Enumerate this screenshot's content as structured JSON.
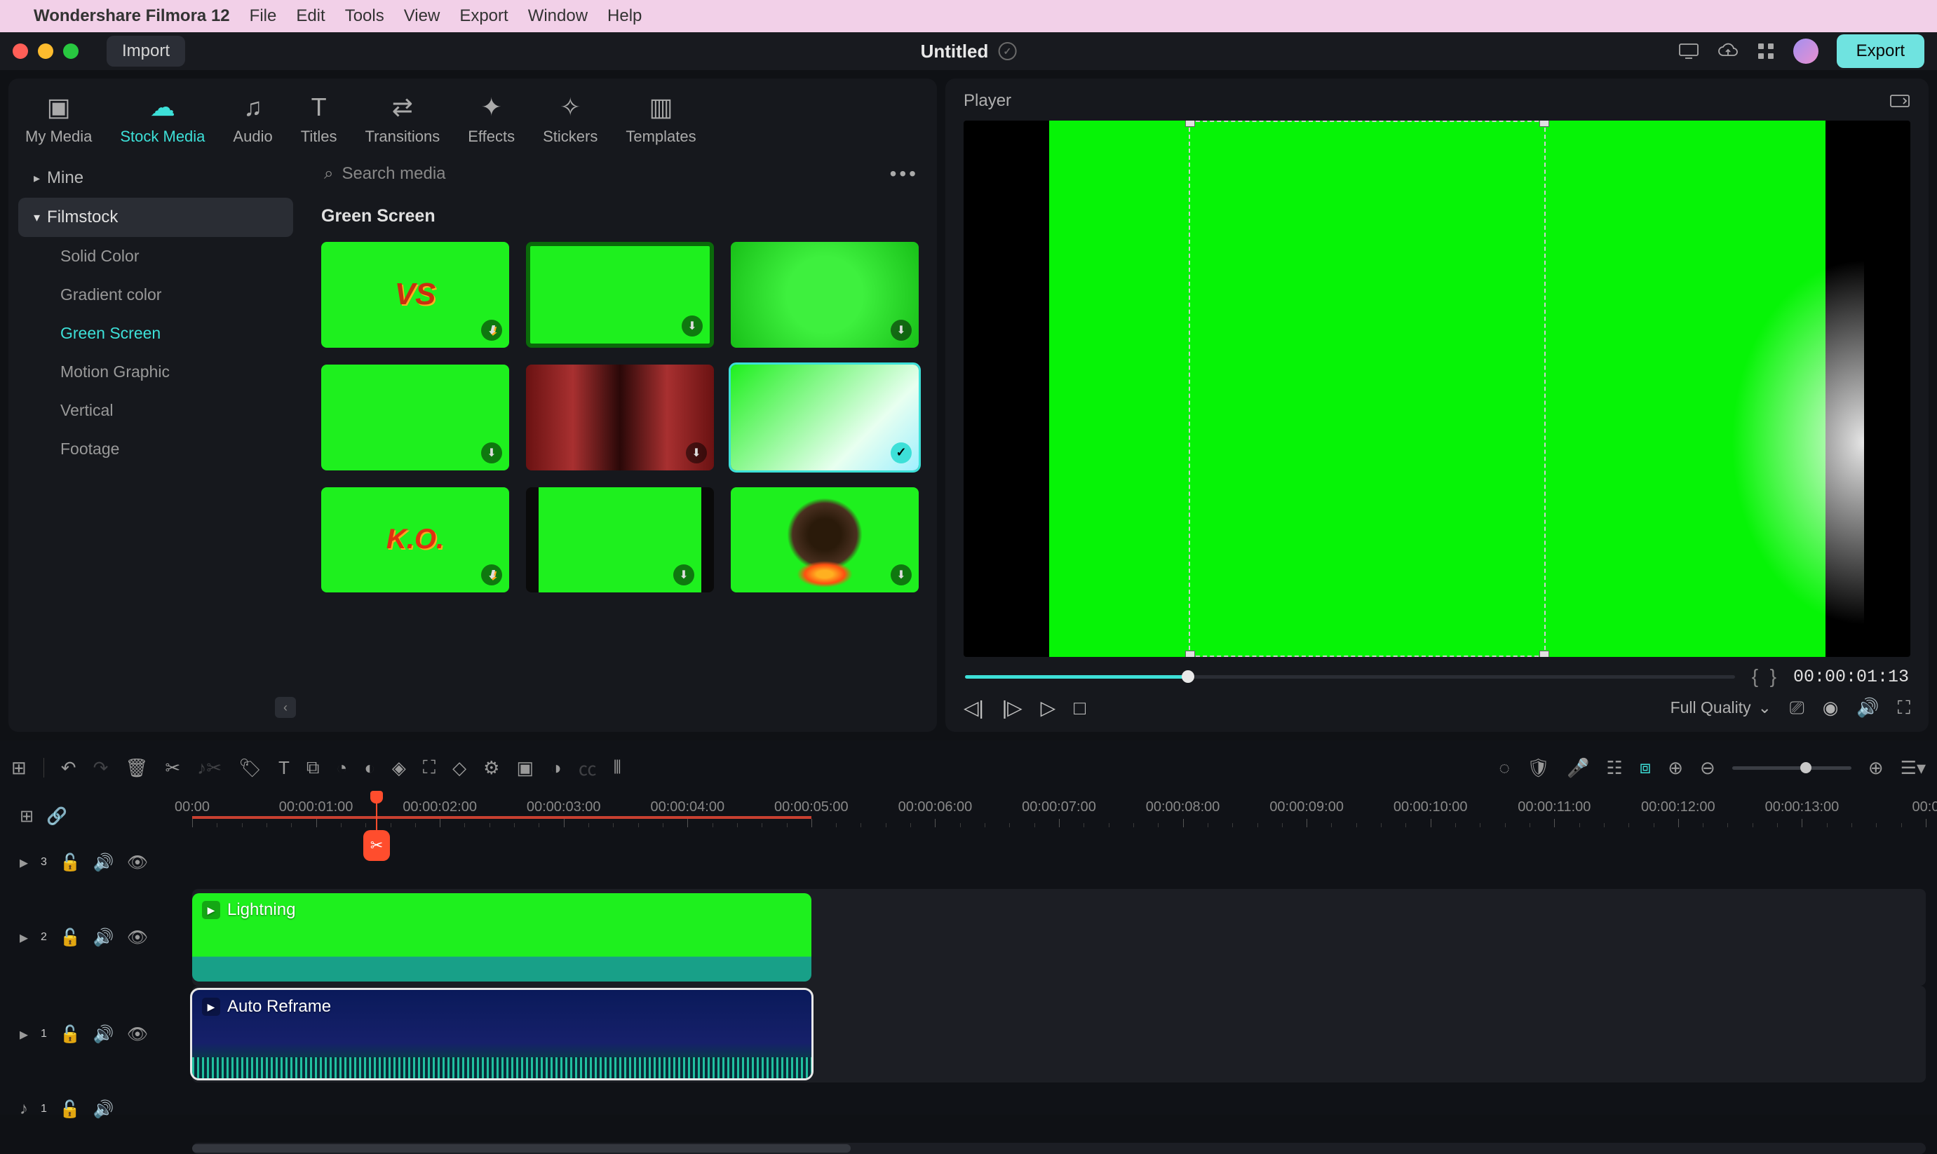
{
  "menubar": {
    "app_name": "Wondershare Filmora 12",
    "items": [
      "File",
      "Edit",
      "Tools",
      "View",
      "Export",
      "Window",
      "Help"
    ]
  },
  "titlebar": {
    "import_label": "Import",
    "document_title": "Untitled",
    "export_label": "Export"
  },
  "media_tabs": [
    {
      "label": "My Media",
      "icon": "folder"
    },
    {
      "label": "Stock Media",
      "icon": "cloud",
      "active": true
    },
    {
      "label": "Audio",
      "icon": "music"
    },
    {
      "label": "Titles",
      "icon": "text"
    },
    {
      "label": "Transitions",
      "icon": "swap"
    },
    {
      "label": "Effects",
      "icon": "sparkle"
    },
    {
      "label": "Stickers",
      "icon": "sticker"
    },
    {
      "label": "Templates",
      "icon": "layout"
    }
  ],
  "sidebar": {
    "mine": "Mine",
    "filmstock": "Filmstock",
    "subitems": [
      "Solid Color",
      "Gradient color",
      "Green Screen",
      "Motion Graphic",
      "Vertical",
      "Footage"
    ],
    "active_sub": "Green Screen"
  },
  "search": {
    "placeholder": "Search media"
  },
  "section_title": "Green Screen",
  "thumbs": [
    {
      "name": "vs-green",
      "dl": true
    },
    {
      "name": "green-dark",
      "dl": true
    },
    {
      "name": "green-burst",
      "dl": true
    },
    {
      "name": "green-plain",
      "dl": true
    },
    {
      "name": "curtain",
      "dl": true
    },
    {
      "name": "lightning",
      "selected": true
    },
    {
      "name": "ko-green",
      "dl": true
    },
    {
      "name": "film-strip",
      "dl": true
    },
    {
      "name": "explosion",
      "dl": true
    }
  ],
  "player": {
    "title": "Player",
    "timecode": "00:00:01:13",
    "quality_label": "Full Quality"
  },
  "timeline": {
    "ruler_labels": [
      "00:00",
      "00:00:01:00",
      "00:00:02:00",
      "00:00:03:00",
      "00:00:04:00",
      "00:00:05:00",
      "00:00:06:00",
      "00:00:07:00",
      "00:00:08:00",
      "00:00:09:00",
      "00:00:10:00",
      "00:00:11:00",
      "00:00:12:00",
      "00:00:13:00",
      "00:0"
    ],
    "tracks": {
      "video3": "3",
      "video2": "2",
      "video1": "1",
      "audio1": "1"
    },
    "clips": {
      "lightning_label": "Lightning",
      "reframe_label": "Auto Reframe"
    }
  }
}
